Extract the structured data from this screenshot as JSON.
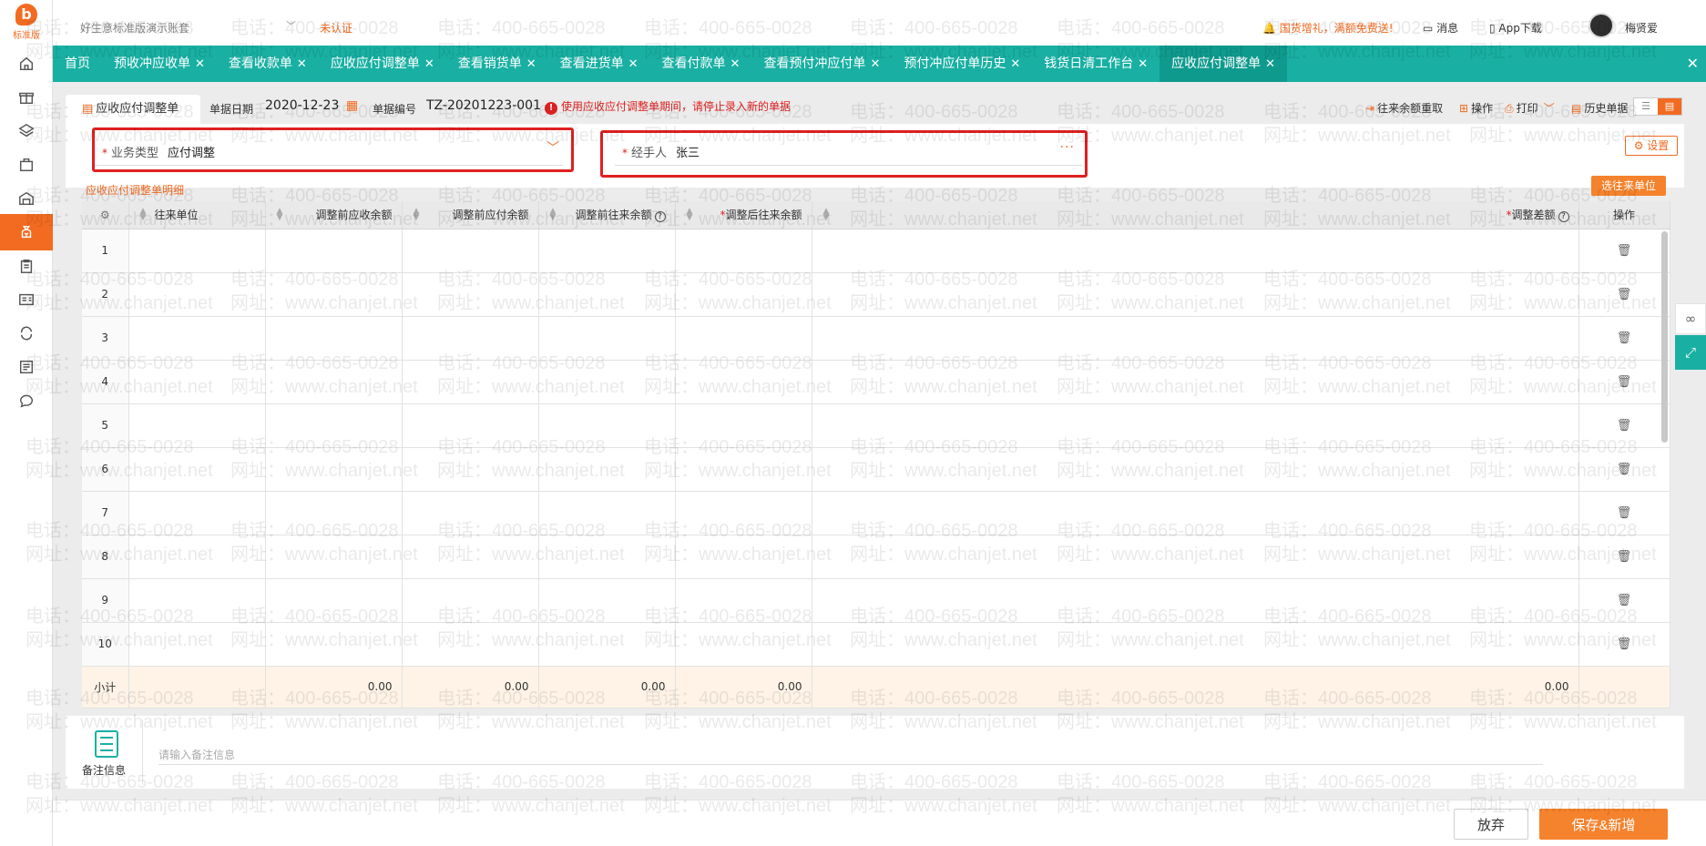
{
  "sidebar": {
    "logo_text": "标准版",
    "items": [
      {
        "icon": "home-icon"
      },
      {
        "icon": "gift-icon"
      },
      {
        "icon": "inventory-icon"
      },
      {
        "icon": "bag-icon"
      },
      {
        "icon": "warehouse-icon"
      },
      {
        "icon": "money-bag-icon",
        "active": true
      },
      {
        "icon": "clipboard-icon"
      },
      {
        "icon": "id-card-icon"
      },
      {
        "icon": "cycle-icon"
      },
      {
        "icon": "news-icon"
      },
      {
        "icon": "chat-icon"
      }
    ]
  },
  "header": {
    "account_name": "好生意标准版演示账套",
    "unverified": "未认证",
    "promo": "国货增礼，满额免费送!",
    "messages": "消息",
    "app_download": "App下载",
    "username": "梅贤爱"
  },
  "tabs": [
    {
      "label": "首页",
      "closable": false
    },
    {
      "label": "预收冲应收单",
      "closable": true
    },
    {
      "label": "查看收款单",
      "closable": true
    },
    {
      "label": "应收应付调整单",
      "closable": true
    },
    {
      "label": "查看销货单",
      "closable": true
    },
    {
      "label": "查看进货单",
      "closable": true
    },
    {
      "label": "查看付款单",
      "closable": true
    },
    {
      "label": "查看预付冲应付单",
      "closable": true
    },
    {
      "label": "预付冲应付单历史",
      "closable": true
    },
    {
      "label": "钱货日清工作台",
      "closable": true
    },
    {
      "label": "应收应付调整单",
      "closable": true,
      "active": true
    }
  ],
  "doc": {
    "tab_label": "应收应付调整单",
    "date_label": "单据日期",
    "date_value": "2020-12-23",
    "number_label": "单据编号",
    "number_value": "TZ-20201223-001",
    "warning": "使用应收应付调整单期间，请停止录入新的单据",
    "tools": {
      "reload_balance": "往来余额重取",
      "operate": "操作",
      "print": "打印",
      "history": "历史单据"
    }
  },
  "form": {
    "business_type_label": "业务类型",
    "business_type_value": "应付调整",
    "handler_label": "经手人",
    "handler_value": "张三",
    "settings": "设置"
  },
  "detail": {
    "section_title": "应收应付调整单明细",
    "select_partner_button": "选往来单位",
    "columns": {
      "partner": "往来单位",
      "pre_receivable": "调整前应收余额",
      "pre_payable": "调整前应付余额",
      "pre_balance": "调整前往来余额",
      "post_balance": "调整后往来余额",
      "diff": "调整差额",
      "ops": "操作"
    },
    "rows": [
      "1",
      "2",
      "3",
      "4",
      "5",
      "6",
      "7",
      "8",
      "9",
      "10"
    ],
    "subtotal": {
      "label": "小计",
      "pre_receivable": "0.00",
      "pre_payable": "0.00",
      "pre_balance": "0.00",
      "post_balance": "0.00",
      "diff": "0.00"
    }
  },
  "remark": {
    "label": "备注信息",
    "placeholder": "请输入备注信息"
  },
  "footer": {
    "cancel": "放弃",
    "save_new": "保存&新增"
  },
  "watermark": {
    "phone": "电话：400-665-0028",
    "website": "网址：www.chanjet.net"
  },
  "colors": {
    "brand_orange": "#f26b21",
    "tab_teal": "#19b0a3",
    "highlight_red": "#e02020"
  }
}
